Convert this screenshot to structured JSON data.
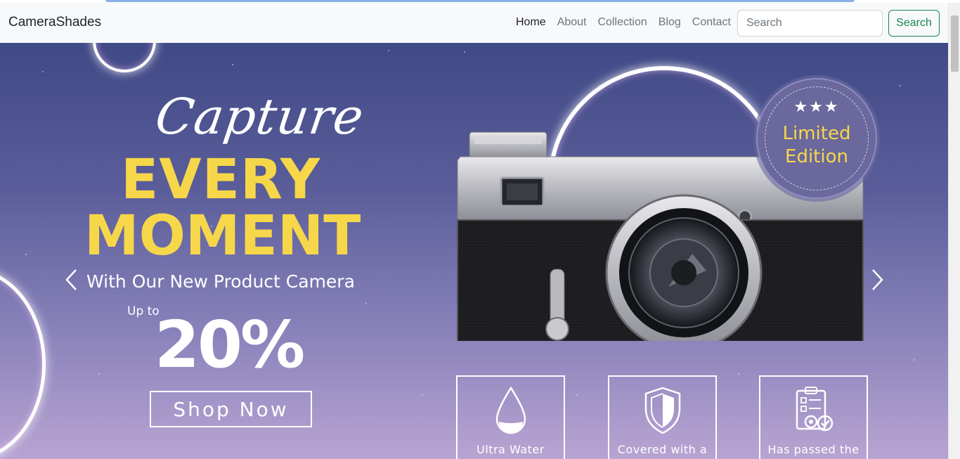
{
  "navbar": {
    "brand": "CameraShades",
    "links": [
      {
        "label": "Home",
        "active": true
      },
      {
        "label": "About",
        "active": false
      },
      {
        "label": "Collection",
        "active": false
      },
      {
        "label": "Blog",
        "active": false
      },
      {
        "label": "Contact",
        "active": false
      }
    ],
    "search_placeholder": "Search",
    "search_button": "Search"
  },
  "hero": {
    "script_title": "Capture",
    "headline_1": "EVERY",
    "headline_2": "MOMENT",
    "subline": "With Our New Product Camera",
    "up_to": "Up to",
    "discount": "20%",
    "cta": "Shop Now",
    "badge": {
      "line1": "Limited",
      "line2": "Edition",
      "stars": "★★★"
    },
    "features": [
      {
        "text": "Ultra Water",
        "icon": "water-drop-icon"
      },
      {
        "text": "Covered with a",
        "icon": "shield-icon"
      },
      {
        "text": "Has passed the",
        "icon": "checklist-gear-icon"
      }
    ]
  },
  "colors": {
    "accent_yellow": "#f7d74a",
    "nav_bg": "#f8f9fa",
    "search_green": "#198754",
    "hero_top": "#404a86",
    "hero_bottom": "#b8a4d2"
  }
}
